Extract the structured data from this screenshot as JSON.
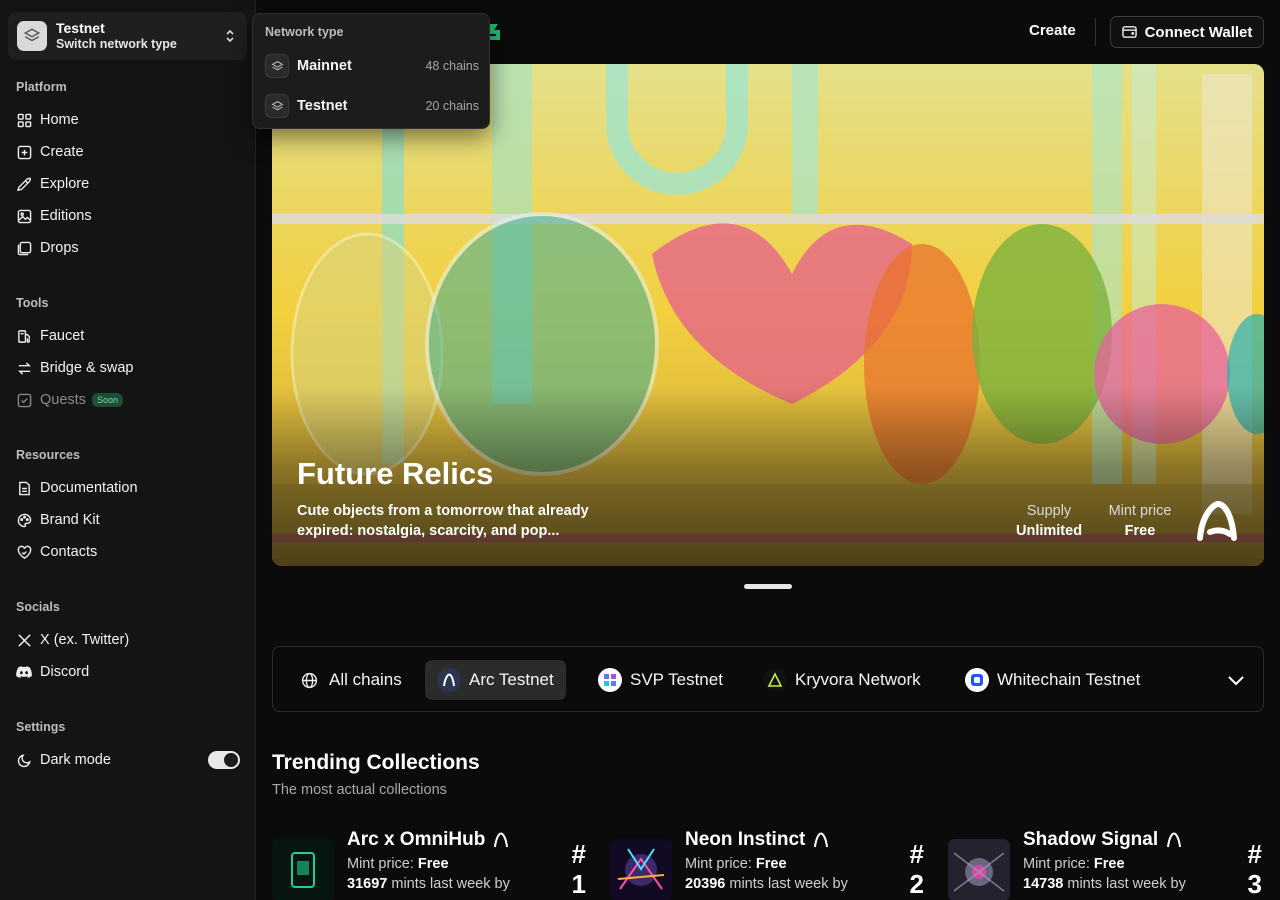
{
  "network": {
    "title": "Testnet",
    "subtitle": "Switch network type"
  },
  "dropdown": {
    "label": "Network type",
    "items": [
      {
        "name": "Mainnet",
        "count": "48 chains"
      },
      {
        "name": "Testnet",
        "count": "20 chains"
      }
    ]
  },
  "sidebar": {
    "platform_label": "Platform",
    "platform": [
      "Home",
      "Create",
      "Explore",
      "Editions",
      "Drops"
    ],
    "tools_label": "Tools",
    "tools": [
      "Faucet",
      "Bridge & swap",
      "Quests"
    ],
    "soon_badge": "Soon",
    "resources_label": "Resources",
    "resources": [
      "Documentation",
      "Brand Kit",
      "Contacts"
    ],
    "socials_label": "Socials",
    "socials": [
      "X (ex. Twitter)",
      "Discord"
    ],
    "settings_label": "Settings",
    "dark_mode_label": "Dark mode",
    "dark_mode_on": true
  },
  "header": {
    "create_label": "Create",
    "wallet_label": "Connect Wallet"
  },
  "hero": {
    "title": "Future Relics",
    "description": "Cute objects from a tomorrow that already expired: nostalgia, scarcity, and pop...",
    "supply_label": "Supply",
    "supply_value": "Unlimited",
    "mint_label": "Mint price",
    "mint_value": "Free"
  },
  "chains": {
    "all_label": "All chains",
    "items": [
      "Arc Testnet",
      "SVP Testnet",
      "Kryvora Network",
      "Whitechain Testnet"
    ],
    "active": "Arc Testnet"
  },
  "trending": {
    "title": "Trending Collections",
    "subtitle": "The most actual collections",
    "mint_price_label": "Mint price:",
    "collections": [
      {
        "name": "Arc x OmniHub",
        "mint_price": "Free",
        "mints": "31697",
        "mints_suffix": "mints last week by",
        "rank_hash": "#",
        "rank": "1"
      },
      {
        "name": "Neon Instinct",
        "mint_price": "Free",
        "mints": "20396",
        "mints_suffix": "mints last week by",
        "rank_hash": "#",
        "rank": "2"
      },
      {
        "name": "Shadow Signal",
        "mint_price": "Free",
        "mints": "14738",
        "mints_suffix": "mints last week by",
        "rank_hash": "#",
        "rank": "3"
      }
    ]
  },
  "colors": {
    "accent_green": "#1fbf77",
    "background": "#0b0b0c",
    "sidebar": "#141414"
  }
}
